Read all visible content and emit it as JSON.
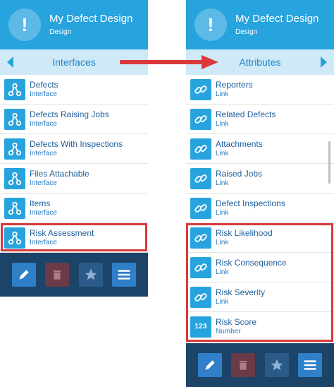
{
  "left": {
    "header": {
      "title": "My Defect Design",
      "subtitle": "Design",
      "icon": "exclamation-icon"
    },
    "subbar": {
      "title": "Interfaces"
    },
    "items": [
      {
        "title": "Defects",
        "type": "Interface",
        "icon": "interface-icon"
      },
      {
        "title": "Defects Raising Jobs",
        "type": "Interface",
        "icon": "interface-icon"
      },
      {
        "title": "Defects With Inspections",
        "type": "Interface",
        "icon": "interface-icon"
      },
      {
        "title": "Files Attachable",
        "type": "Interface",
        "icon": "interface-icon"
      },
      {
        "title": "Items",
        "type": "Interface",
        "icon": "interface-icon"
      },
      {
        "title": "Risk Assessment",
        "type": "Interface",
        "icon": "interface-icon"
      }
    ],
    "toolbar": [
      "edit-icon",
      "trash-icon",
      "star-icon",
      "menu-icon"
    ]
  },
  "right": {
    "header": {
      "title": "My Defect Design",
      "subtitle": "Design",
      "icon": "exclamation-icon"
    },
    "subbar": {
      "title": "Attributes"
    },
    "items": [
      {
        "title": "Reporters",
        "type": "Link",
        "icon": "link-icon"
      },
      {
        "title": "Related Defects",
        "type": "Link",
        "icon": "link-icon"
      },
      {
        "title": "Attachments",
        "type": "Link",
        "icon": "link-icon"
      },
      {
        "title": "Raised Jobs",
        "type": "Link",
        "icon": "link-icon"
      },
      {
        "title": "Defect Inspections",
        "type": "Link",
        "icon": "link-icon"
      },
      {
        "title": "Risk Likelihood",
        "type": "Link",
        "icon": "link-icon"
      },
      {
        "title": "Risk Consequence",
        "type": "Link",
        "icon": "link-icon"
      },
      {
        "title": "Risk Severity",
        "type": "Link",
        "icon": "link-icon"
      },
      {
        "title": "Risk Score",
        "type": "Number",
        "icon": "number-icon",
        "icon_label": "123"
      }
    ],
    "toolbar": [
      "edit-icon",
      "trash-icon",
      "star-icon",
      "menu-icon"
    ]
  },
  "colors": {
    "primary": "#27a3de",
    "subbar": "#cfe9f7",
    "toolbar": "#1c4468",
    "highlight": "#d9393a"
  }
}
